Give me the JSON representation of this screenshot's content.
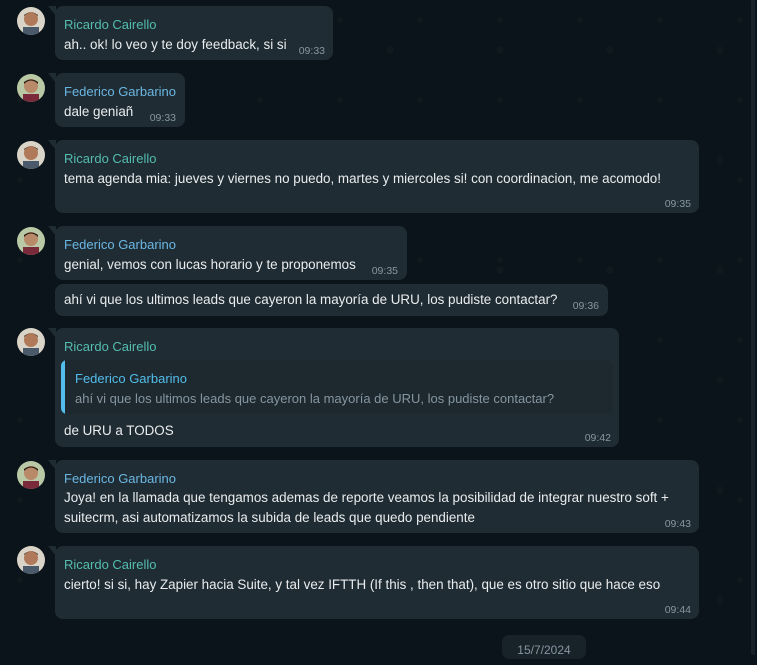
{
  "messages": [
    {
      "sender": "Ricardo Cairello",
      "text": "ah.. ok! lo veo y te doy feedback, si si",
      "time": "09:33"
    },
    {
      "sender": "Federico Garbarino",
      "text": "dale geniañ",
      "time": "09:33"
    },
    {
      "sender": "Ricardo Cairello",
      "text": "tema agenda mia: jueves y viernes no puedo, martes y miercoles si! con coordinacion, me acomodo!",
      "time": "09:35"
    },
    {
      "sender": "Federico Garbarino",
      "text": "genial, vemos con lucas horario y te proponemos",
      "time": "09:35"
    },
    {
      "sender": "",
      "text": "ahí vi que los ultimos leads que cayeron la mayoría de URU, los pudiste contactar?",
      "time": "09:36"
    },
    {
      "sender": "Ricardo Cairello",
      "quote_sender": "Federico Garbarino",
      "quote_text": "ahí vi que los ultimos leads que cayeron la mayoría de URU, los pudiste contactar?",
      "text": "de URU a TODOS",
      "time": "09:42"
    },
    {
      "sender": "Federico Garbarino",
      "text_line1": "Joya! en la llamada que tengamos ademas de reporte veamos la posibilidad de integrar nuestro soft +",
      "text_line2": "suitecrm, asi automatizamos la subida de leads que quedo pendiente",
      "time": "09:43"
    },
    {
      "sender": "Ricardo Cairello",
      "text": "cierto! si si, hay Zapier hacia Suite, y tal vez IFTTH (If this , then that), que es otro sitio que hace eso",
      "time": "09:44"
    }
  ],
  "date_separator": "15/7/2024",
  "colors": {
    "background": "#0b141a",
    "bubble": "#202c33",
    "ricardo_name": "#53bdb0",
    "federico_name": "#6ab7e4",
    "quote_bar": "#53bdeb"
  }
}
